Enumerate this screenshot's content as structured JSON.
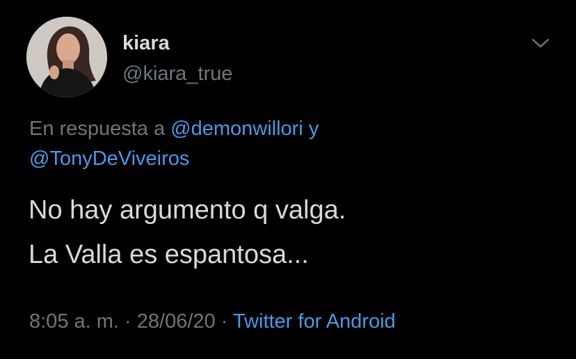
{
  "tweet": {
    "author": {
      "display_name": "kiara",
      "handle": "@kiara_true"
    },
    "reply": {
      "prefix": "En respuesta a",
      "mention_1": "@demonwillori",
      "conjunction": "y",
      "mention_2": "@TonyDeViveiros"
    },
    "text_lines": [
      "No hay argumento q valga.",
      "La Valla es espantosa..."
    ],
    "time": "8:05 a. m.",
    "date": "28/06/20",
    "separator": "·",
    "source": "Twitter for Android"
  },
  "icons": {
    "more": "chevron-down-icon",
    "avatar": "avatar"
  },
  "colors": {
    "background": "#000000",
    "text": "#d9d9d9",
    "secondary": "#6e767d",
    "link": "#4a99e9"
  }
}
